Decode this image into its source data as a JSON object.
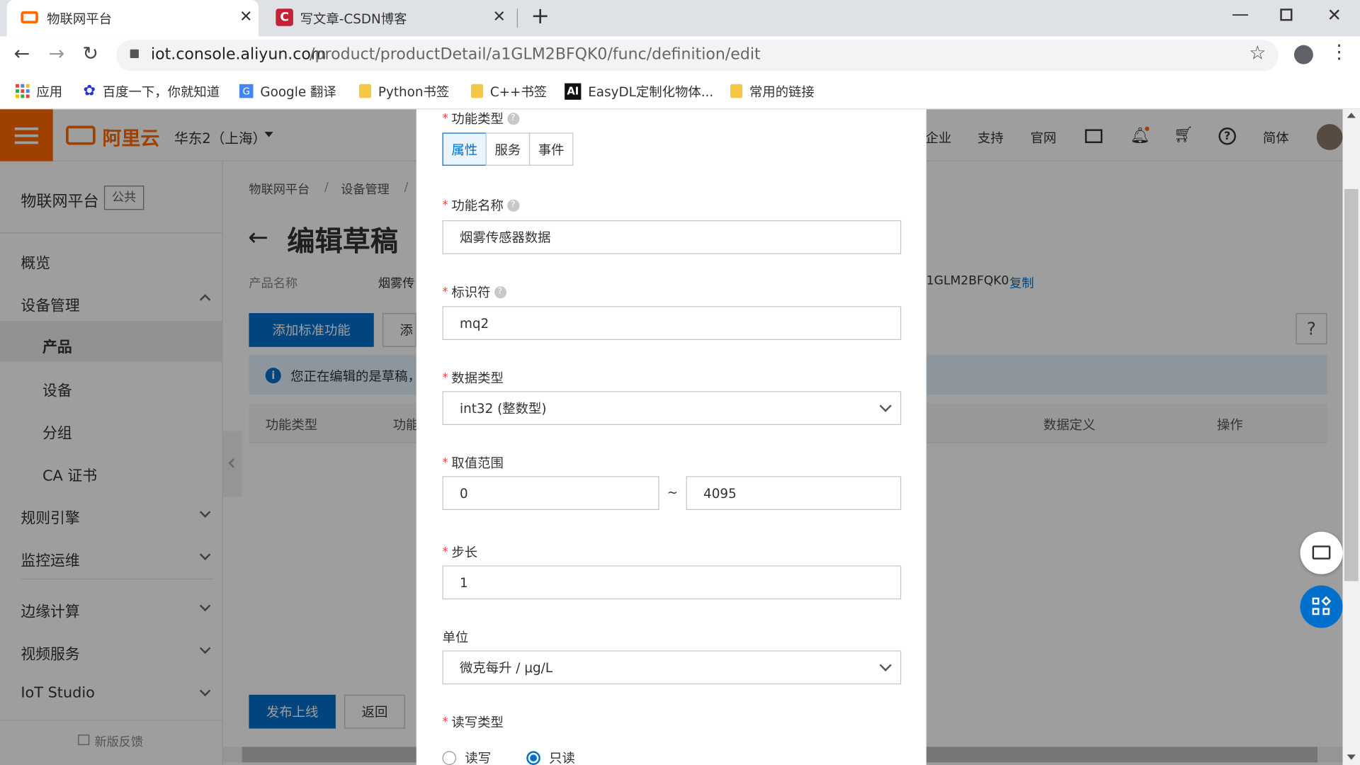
{
  "browser": {
    "tabs": [
      {
        "title": "物联网平台",
        "icon": "aliyun-logo-icon"
      },
      {
        "title": "写文章-CSDN博客",
        "icon": "csdn-logo-icon"
      }
    ],
    "url_host": "iot.console.aliyun.com",
    "url_path": "/product/productDetail/a1GLM2BFQK0/func/definition/edit",
    "bookmarks": [
      "应用",
      "百度一下，你就知道",
      "Google 翻译",
      "Python书签",
      "C++书签",
      "EasyDL定制化物体...",
      "常用的链接"
    ]
  },
  "topnav": {
    "brand": "阿里云",
    "region": "华东2（上海）",
    "links": [
      "企业",
      "支持",
      "官网"
    ],
    "lang": "简体"
  },
  "sidebar": {
    "title": "物联网平台",
    "badge": "公共",
    "overview": "概览",
    "device_mgmt": "设备管理",
    "sub_items": [
      "产品",
      "设备",
      "分组",
      "CA 证书"
    ],
    "groups": [
      "规则引擎",
      "监控运维",
      "边缘计算",
      "视频服务",
      "IoT Studio"
    ],
    "feedback": "新版反馈"
  },
  "main": {
    "breadcrumb": [
      "物联网平台",
      "设备管理"
    ],
    "title": "编辑草稿",
    "product_name_label": "产品名称",
    "product_name_value": "烟雾传",
    "product_key_partial": "1GLM2BFQK0",
    "copy": "复制",
    "add_std_btn": "添加标准功能",
    "add_btn": "添",
    "info_text": "您正在编辑的是草稿，",
    "table_headers": [
      "功能类型",
      "功能",
      "数据定义",
      "操作"
    ],
    "publish_btn": "发布上线",
    "back_btn": "返回",
    "help_q": "?"
  },
  "modal": {
    "func_type_label": "功能类型",
    "func_types": [
      "属性",
      "服务",
      "事件"
    ],
    "func_name_label": "功能名称",
    "func_name_value": "烟雾传感器数据",
    "identifier_label": "标识符",
    "identifier_value": "mq2",
    "data_type_label": "数据类型",
    "data_type_value": "int32 (整数型)",
    "range_label": "取值范围",
    "range_min": "0",
    "range_sep": "~",
    "range_max": "4095",
    "step_label": "步长",
    "step_value": "1",
    "unit_label": "单位",
    "unit_value": "微克每升 / μg/L",
    "rw_label": "读写类型",
    "rw_options": [
      "读写",
      "只读"
    ],
    "rw_selected": "只读"
  }
}
